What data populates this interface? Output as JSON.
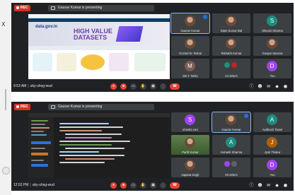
{
  "meetings": [
    {
      "rec": "REC",
      "presenting": "Gaurav Kumar is presenting",
      "share": {
        "site": "data.gov.in",
        "headline": "HIGH VALUE DATASETS"
      },
      "tiles": [
        {
          "name": "Gaurav Kumar",
          "kind": "photo",
          "active": true
        },
        {
          "name": "Bipin Kumar Bal",
          "kind": "photo"
        },
        {
          "name": "Shivani Sharma",
          "kind": "letter",
          "letter": "S",
          "color": "#1e8e7e"
        },
        {
          "name": "Govind Kr. Rahul",
          "kind": "photo"
        },
        {
          "name": "Rishabh Kumar",
          "kind": "photo"
        },
        {
          "name": "Gunjan Saxena",
          "kind": "photo"
        },
        {
          "name": "Ms.T. Neha",
          "kind": "letter",
          "letter": "M",
          "color": "#7f5a52"
        },
        {
          "name": "24 others",
          "kind": "others"
        },
        {
          "name": "You",
          "kind": "letter",
          "letter": "D",
          "color": "#a142f4"
        }
      ],
      "time": "9:53 AM",
      "code": "uky-uhsg-wud"
    },
    {
      "rec": "REC",
      "presenting": "Gaurav Kumar is presenting",
      "tiles": [
        {
          "name": "sheetla rani",
          "kind": "letter",
          "letter": "S",
          "color": "#a142f4"
        },
        {
          "name": "Gaurav Kumar",
          "kind": "photo",
          "active": true
        },
        {
          "name": "Avdhesh Tiwari",
          "kind": "letter",
          "letter": "A",
          "color": "#1e8e7e"
        },
        {
          "name": "Parth Kumar",
          "kind": "photo"
        },
        {
          "name": "Avinash Sharma",
          "kind": "letter",
          "letter": "A",
          "color": "#1e8e7e"
        },
        {
          "name": "Jyoti Thakur",
          "kind": "letter",
          "letter": "J",
          "color": "#b06000"
        },
        {
          "name": "sapana singh",
          "kind": "photo"
        },
        {
          "name": "29 others",
          "kind": "others"
        },
        {
          "name": "You",
          "kind": "letter",
          "letter": "D",
          "color": "#a142f4"
        }
      ],
      "time": "12:52 PM",
      "code": "uky-uhsg-wud"
    }
  ],
  "left_strip": {
    "close_glyph": "X"
  },
  "icons": {
    "mic": "mic-icon",
    "camera": "camera-icon",
    "captions": "captions-icon",
    "raise_hand": "raise-hand-icon",
    "present": "present-icon",
    "more": "more-options-icon",
    "end": "end-call-icon",
    "info": "info-icon",
    "people": "people-icon",
    "chat": "chat-icon",
    "activities": "activities-icon",
    "lock": "host-controls-icon"
  },
  "colors": {
    "accent": "#8ab4f8",
    "danger": "#ea4335",
    "meet_bg": "#202124",
    "tile_bg": "#3c4043"
  }
}
